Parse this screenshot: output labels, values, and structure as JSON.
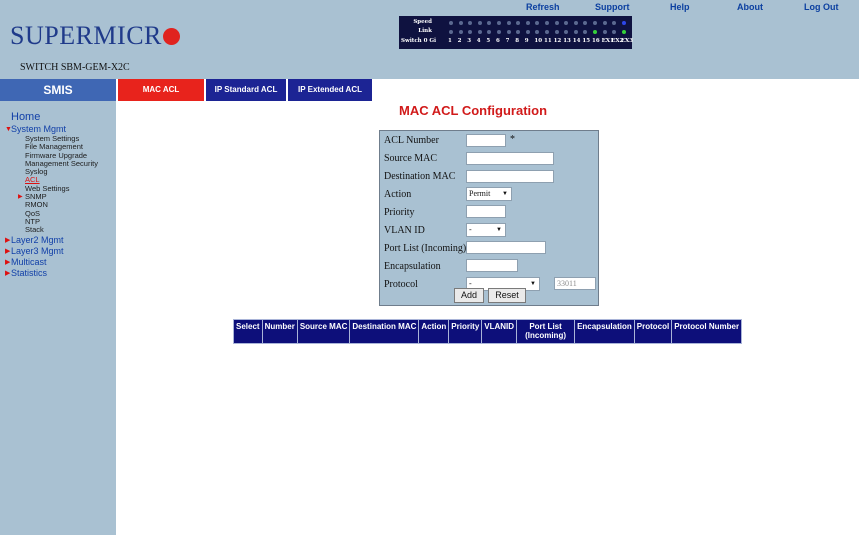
{
  "top_links": [
    "Refresh",
    "Support",
    "Help",
    "About",
    "Log Out"
  ],
  "brand": {
    "logo": "SUPERMICR",
    "model": "SWITCH SBM-GEM-X2C"
  },
  "port_panel": {
    "row_labels": [
      "Speed",
      "Link",
      "Switch 0 Gi"
    ],
    "port_numbers": [
      "1",
      "2",
      "3",
      "4",
      "5",
      "6",
      "7",
      "8",
      "9",
      "10",
      "11",
      "12",
      "13",
      "14",
      "15",
      "16",
      "EX1",
      "EX2",
      "EX3"
    ]
  },
  "sidebar": {
    "header": "SMIS",
    "home": "Home",
    "system_mgmt": "System Mgmt",
    "system_items": [
      "System Settings",
      "File Management",
      "Firmware Upgrade",
      "Management Security",
      "Syslog",
      "ACL",
      "Web Settings",
      "SNMP",
      "RMON",
      "QoS",
      "NTP",
      "Stack"
    ],
    "categories": [
      "Layer2 Mgmt",
      "Layer3 Mgmt",
      "Multicast",
      "Statistics"
    ]
  },
  "tabs": [
    "MAC ACL",
    "IP Standard ACL",
    "IP Extended ACL"
  ],
  "page_title": "MAC ACL Configuration",
  "form": {
    "acl_number_label": "ACL Number",
    "required_mark": "*",
    "source_mac_label": "Source MAC",
    "destination_mac_label": "Destination MAC",
    "action_label": "Action",
    "action_value": "Permit",
    "priority_label": "Priority",
    "vlan_id_label": "VLAN ID",
    "vlan_id_value": "-",
    "port_list_label": "Port List (Incoming)",
    "encapsulation_label": "Encapsulation",
    "protocol_label": "Protocol",
    "protocol_value": "-",
    "protocol_number": "33011",
    "add_label": "Add",
    "reset_label": "Reset"
  },
  "table_headers": [
    "Select",
    "Number",
    "Source MAC",
    "Destination MAC",
    "Action",
    "Priority",
    "VLANID",
    "Port List (Incoming)",
    "Encapsulation",
    "Protocol",
    "Protocol Number"
  ],
  "colors": {
    "banner": "#a9c1d2",
    "smis_header": "#3f67b4",
    "active_tab": "#e8231c",
    "tab": "#1c2494",
    "title": "#d11a1a",
    "table_header": "#0d0f7a"
  }
}
